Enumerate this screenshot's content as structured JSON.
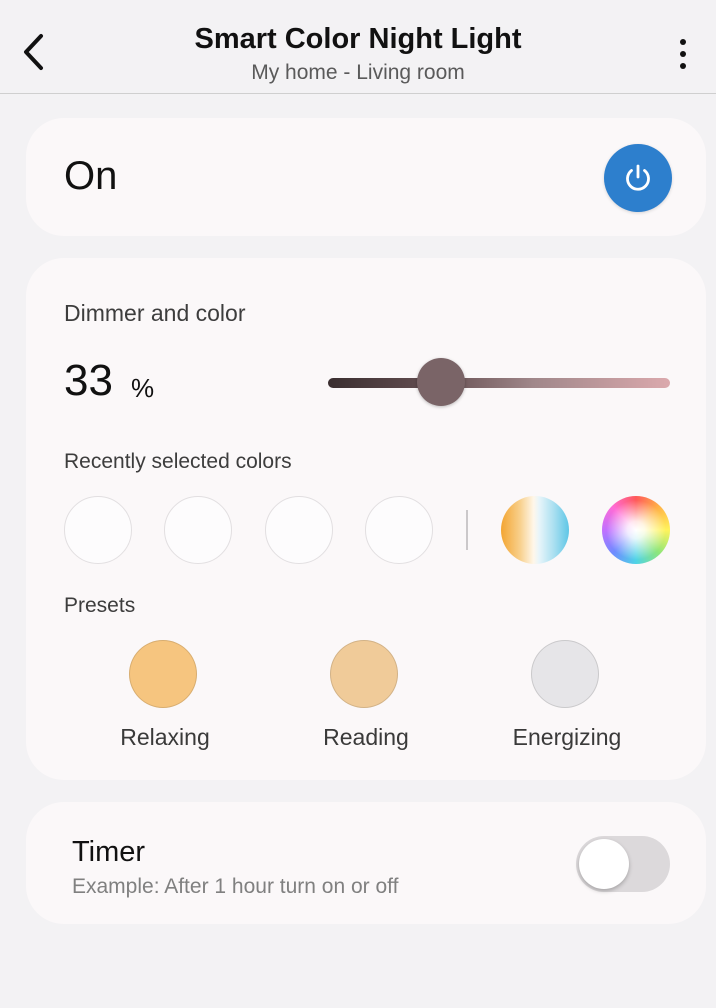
{
  "header": {
    "title": "Smart Color Night Light",
    "subtitle": "My home - Living room"
  },
  "power": {
    "state_label": "On",
    "on": true,
    "button_color": "#2d7fcd"
  },
  "dimmer": {
    "label": "Dimmer and color",
    "value": "33",
    "unit": "%",
    "level_fraction": 0.33
  },
  "recent_colors": {
    "label": "Recently selected colors",
    "empty_slots": 4,
    "tools": [
      "color-temperature-icon",
      "color-wheel-icon"
    ]
  },
  "presets": {
    "label": "Presets",
    "items": [
      {
        "label": "Relaxing",
        "color": "#f6c57f"
      },
      {
        "label": "Reading",
        "color": "#f0cb99"
      },
      {
        "label": "Energizing",
        "color": "#e6e5e8"
      }
    ]
  },
  "timer": {
    "title": "Timer",
    "description": "Example: After 1 hour turn on or off",
    "enabled": false
  }
}
